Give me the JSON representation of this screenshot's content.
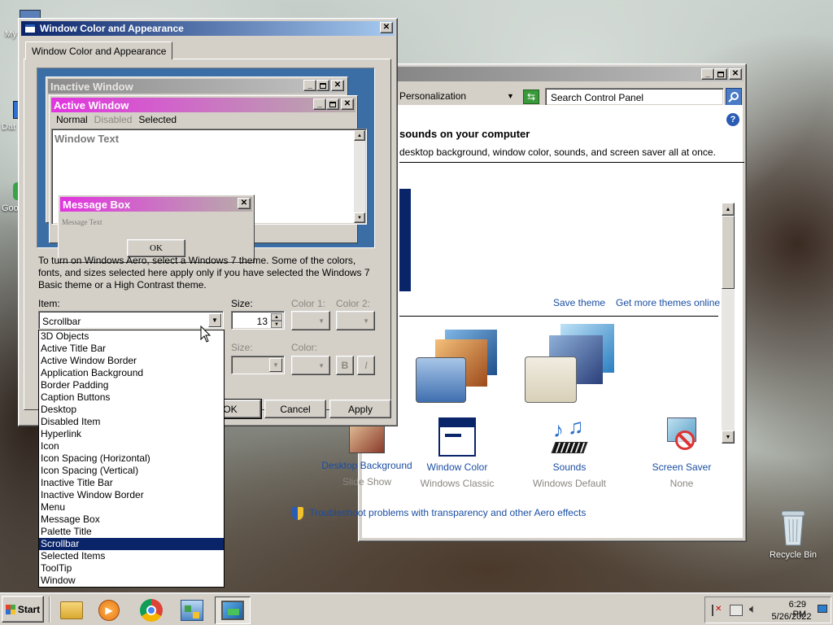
{
  "desktop": {
    "icons": [
      {
        "label": "My",
        "name": "my-computer"
      },
      {
        "label": "Dat",
        "name": "data"
      },
      {
        "label": "Goo",
        "name": "google"
      }
    ],
    "recycle_bin": "Recycle Bin"
  },
  "control_panel": {
    "address": "Personalization",
    "search_placeholder": "Search Control Panel",
    "heading": "sounds on your computer",
    "subheading": "desktop background, window color, sounds, and screen saver all at once.",
    "save_theme": "Save theme",
    "more_themes": "Get more themes online",
    "bottom_items": [
      {
        "title": "Desktop Background",
        "sub": "Slide Show"
      },
      {
        "title": "Window Color",
        "sub": "Windows Classic"
      },
      {
        "title": "Sounds",
        "sub": "Windows Default"
      },
      {
        "title": "Screen Saver",
        "sub": "None"
      }
    ],
    "troubleshoot": "Troubleshoot problems with transparency and other Aero effects"
  },
  "dialog": {
    "title": "Window Color and Appearance",
    "tab": "Window Color and Appearance",
    "preview": {
      "inactive_window": "Inactive Window",
      "active_window": "Active Window",
      "menu_normal": "Normal",
      "menu_disabled": "Disabled",
      "menu_selected": "Selected",
      "window_text": "Window Text",
      "message_box": "Message Box",
      "message_text": "Message Text",
      "ok": "OK"
    },
    "info_text": "To turn on Windows Aero, select a Windows 7 theme.  Some of the colors, fonts, and sizes selected here apply only if you have selected the Windows 7 Basic theme or a High Contrast theme.",
    "item_label": "Item:",
    "item_value": "Scrollbar",
    "size_label": "Size:",
    "size_value": "13",
    "color1_label": "Color 1:",
    "color2_label": "Color 2:",
    "font_size_label": "Size:",
    "font_color_label": "Color:",
    "bold": "B",
    "italic": "I",
    "ok": "OK",
    "cancel": "Cancel",
    "apply": "Apply",
    "item_options": [
      "3D Objects",
      "Active Title Bar",
      "Active Window Border",
      "Application Background",
      "Border Padding",
      "Caption Buttons",
      "Desktop",
      "Disabled Item",
      "Hyperlink",
      "Icon",
      "Icon Spacing (Horizontal)",
      "Icon Spacing (Vertical)",
      "Inactive Title Bar",
      "Inactive Window Border",
      "Menu",
      "Message Box",
      "Palette Title",
      "Scrollbar",
      "Selected Items",
      "ToolTip",
      "Window"
    ],
    "selected_index": 17
  },
  "taskbar": {
    "start": "Start",
    "time": "6:29 PM",
    "date": "5/26/2022"
  },
  "colors": {
    "active_title": "#0a246a",
    "preview_active_title": "#e233e0",
    "preview_desktop": "#3a6ea5",
    "link": "#1a4ea3"
  }
}
